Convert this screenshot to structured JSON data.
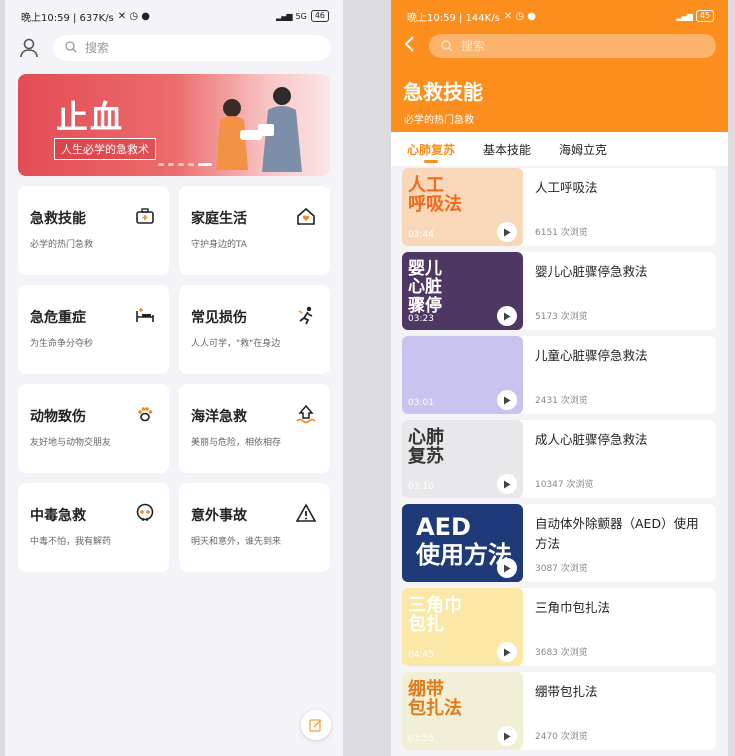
{
  "left": {
    "status": {
      "time": "晚上10:59 | 637K/s",
      "battery": "46",
      "network": "5G"
    },
    "search_placeholder": "搜索",
    "banner": {
      "title": "止血",
      "subtitle": "人生必学的急救术",
      "slide_count": 5,
      "active_slide": 5
    },
    "categories": [
      {
        "title": "急救技能",
        "desc": "必学的热门急救",
        "icon": "first-aid-kit-icon"
      },
      {
        "title": "家庭生活",
        "desc": "守护身边的TA",
        "icon": "home-heart-icon"
      },
      {
        "title": "急危重症",
        "desc": "为生命争分夺秒",
        "icon": "hospital-bed-icon"
      },
      {
        "title": "常见损伤",
        "desc": "人人可学，\"救\"在身边",
        "icon": "injured-person-icon"
      },
      {
        "title": "动物致伤",
        "desc": "友好地与动物交朋友",
        "icon": "paw-icon"
      },
      {
        "title": "海洋急救",
        "desc": "美丽与危险，相依相存",
        "icon": "wave-icon"
      },
      {
        "title": "中毒急救",
        "desc": "中毒不怕，我有解药",
        "icon": "skull-icon"
      },
      {
        "title": "意外事故",
        "desc": "明天和意外，谁先到来",
        "icon": "warning-icon"
      }
    ]
  },
  "right": {
    "status": {
      "time": "晚上10:59 | 144K/s",
      "battery": "45"
    },
    "search_placeholder": "搜索",
    "title": "急救技能",
    "subtitle": "必学的热门急救",
    "tabs": [
      "心肺复苏",
      "基本技能",
      "海姆立克"
    ],
    "active_tab": 0,
    "videos": [
      {
        "title": "人工呼吸法",
        "views": "6151 次浏览",
        "duration": "03:44",
        "thumb_text": "人工\n呼吸法",
        "thumb_bg": "#f9d7b9",
        "thumb_color": "#f26a1b"
      },
      {
        "title": "婴儿心脏骤停急救法",
        "views": "5173 次浏览",
        "duration": "03:23",
        "thumb_text": "婴儿\n心脏\n骤停",
        "thumb_bg": "#4d3763",
        "thumb_color": "#ffffff"
      },
      {
        "title": "儿童心脏骤停急救法",
        "views": "2431 次浏览",
        "duration": "03:01",
        "thumb_text": "",
        "thumb_bg": "#c9c4ef",
        "thumb_color": "#ffffff"
      },
      {
        "title": "成人心脏骤停急救法",
        "views": "10347 次浏览",
        "duration": "03:10",
        "thumb_text": "心肺\n复苏",
        "thumb_bg": "#e8e8ea",
        "thumb_color": "#333333"
      },
      {
        "title": "自动体外除颤器（AED）使用方法",
        "views": "3087 次浏览",
        "duration": "",
        "thumb_text": "AED\n使用方法",
        "thumb_bg": "#1f3a78",
        "thumb_color": "#ffffff"
      },
      {
        "title": "三角巾包扎法",
        "views": "3683 次浏览",
        "duration": "04:45",
        "thumb_text": "三角巾\n包扎",
        "thumb_bg": "#fbe7a6",
        "thumb_color": "#ffffff"
      },
      {
        "title": "绷带包扎法",
        "views": "2470 次浏览",
        "duration": "03:55",
        "thumb_text": "绷带\n包扎法",
        "thumb_bg": "#f1f0d6",
        "thumb_color": "#e07b1a"
      }
    ]
  },
  "colors": {
    "accent": "#fb8e1d",
    "banner_red": "#e24d55"
  }
}
